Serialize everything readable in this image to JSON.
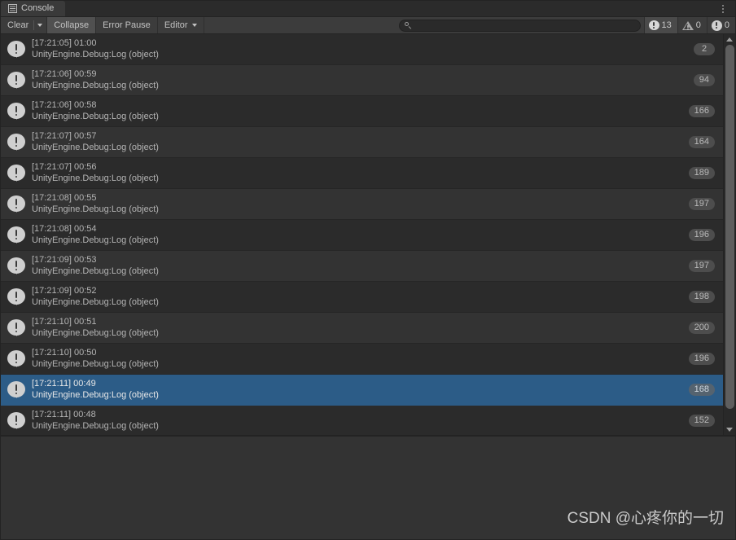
{
  "window": {
    "tab_icon": "console-list-icon",
    "tab_label": "Console",
    "menu_icon": "kebab-menu-icon"
  },
  "toolbar": {
    "clear_label": "Clear",
    "clear_dropdown_icon": "chevron-down-icon",
    "collapse_label": "Collapse",
    "collapse_active": true,
    "error_pause_label": "Error Pause",
    "editor_label": "Editor",
    "editor_dropdown_icon": "chevron-down-icon",
    "search": {
      "icon": "search-icon",
      "value": "",
      "placeholder": ""
    },
    "counters": [
      {
        "icon": "log-info-icon",
        "count": "13",
        "active": true
      },
      {
        "icon": "warning-triangle-icon",
        "count": "0",
        "active": false
      },
      {
        "icon": "error-circle-icon",
        "count": "0",
        "active": false
      }
    ]
  },
  "log": {
    "entries": [
      {
        "timestamp": "[17:21:05] 01:00",
        "source": "UnityEngine.Debug:Log (object)",
        "count": "2",
        "selected": false
      },
      {
        "timestamp": "[17:21:06] 00:59",
        "source": "UnityEngine.Debug:Log (object)",
        "count": "94",
        "selected": false
      },
      {
        "timestamp": "[17:21:06] 00:58",
        "source": "UnityEngine.Debug:Log (object)",
        "count": "166",
        "selected": false
      },
      {
        "timestamp": "[17:21:07] 00:57",
        "source": "UnityEngine.Debug:Log (object)",
        "count": "164",
        "selected": false
      },
      {
        "timestamp": "[17:21:07] 00:56",
        "source": "UnityEngine.Debug:Log (object)",
        "count": "189",
        "selected": false
      },
      {
        "timestamp": "[17:21:08] 00:55",
        "source": "UnityEngine.Debug:Log (object)",
        "count": "197",
        "selected": false
      },
      {
        "timestamp": "[17:21:08] 00:54",
        "source": "UnityEngine.Debug:Log (object)",
        "count": "196",
        "selected": false
      },
      {
        "timestamp": "[17:21:09] 00:53",
        "source": "UnityEngine.Debug:Log (object)",
        "count": "197",
        "selected": false
      },
      {
        "timestamp": "[17:21:09] 00:52",
        "source": "UnityEngine.Debug:Log (object)",
        "count": "198",
        "selected": false
      },
      {
        "timestamp": "[17:21:10] 00:51",
        "source": "UnityEngine.Debug:Log (object)",
        "count": "200",
        "selected": false
      },
      {
        "timestamp": "[17:21:10] 00:50",
        "source": "UnityEngine.Debug:Log (object)",
        "count": "196",
        "selected": false
      },
      {
        "timestamp": "[17:21:11] 00:49",
        "source": "UnityEngine.Debug:Log (object)",
        "count": "168",
        "selected": true
      },
      {
        "timestamp": "[17:21:11] 00:48",
        "source": "UnityEngine.Debug:Log (object)",
        "count": "152",
        "selected": false
      }
    ]
  },
  "scrollbar": {
    "up_icon": "scroll-up-arrow-icon",
    "down_icon": "scroll-down-arrow-icon"
  },
  "detail": {
    "text": "",
    "watermark": "CSDN @心疼你的一切"
  },
  "colors": {
    "selection_blue": "#2c5c87",
    "panel_bg": "#333333",
    "row_even": "#2b2b2b",
    "row_odd": "#333333",
    "badge_bg": "#4d4d4d",
    "text": "#b4b4b4"
  }
}
